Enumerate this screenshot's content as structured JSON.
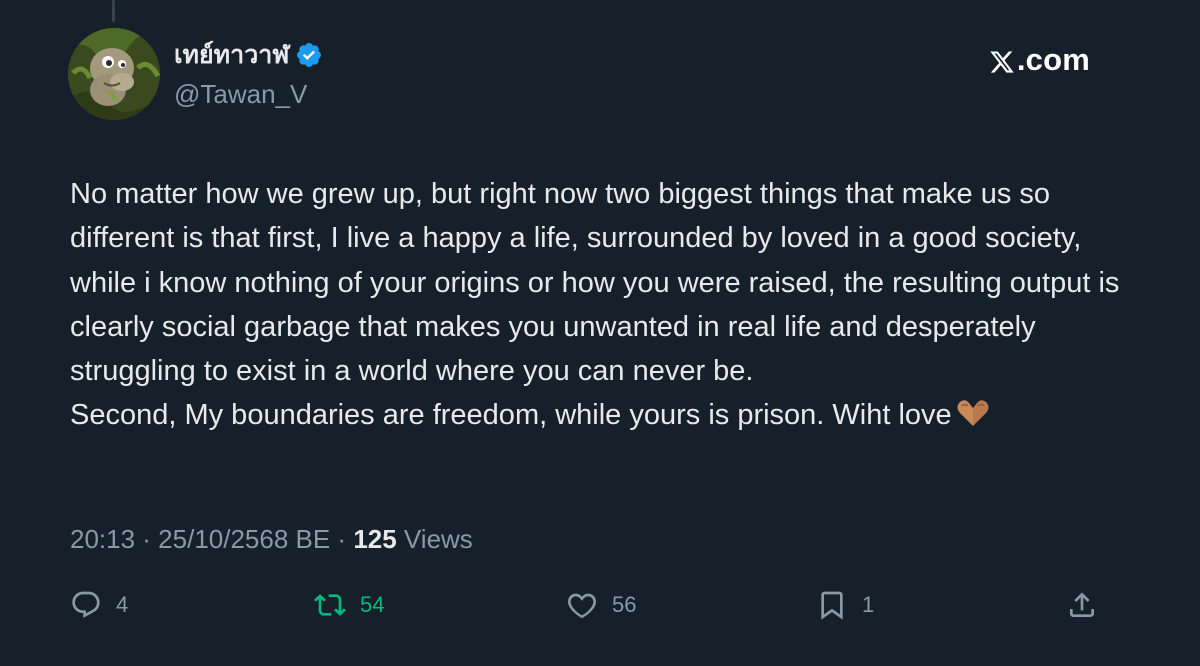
{
  "tweet": {
    "display_name": "เทย์ทาวาฬ",
    "handle": "@Tawan_V",
    "brand": ".com",
    "body": "No matter how we grew up, but right now two biggest things that make us so different is that first, I live a happy a life, surrounded by loved in a good society, while i know nothing of your origins or how you were raised, the resulting output is clearly social garbage that makes you unwanted in real life and desperately struggling to exist in a world where you can never be.\nSecond, My boundaries are freedom, while yours is prison. Wiht love",
    "emoji": "heart-hands-emoji",
    "timestamp": "20:13 · 25/10/2568 BE · ",
    "views_count": "125",
    "views_label": " Views",
    "replies": "4",
    "retweets": "54",
    "likes": "56",
    "bookmarks": "1"
  },
  "colors": {
    "background": "#15202b",
    "text": "#e7e9ea",
    "muted": "#8b98a5",
    "verified": "#1d9bf0",
    "retweet": "#00ba7c"
  },
  "icons": [
    "verified-badge-icon",
    "x-logo-icon",
    "reply-icon",
    "retweet-icon",
    "like-icon",
    "bookmark-icon",
    "share-icon"
  ]
}
